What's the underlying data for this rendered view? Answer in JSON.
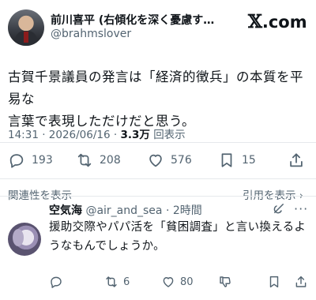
{
  "tweet": {
    "author_name": "前川喜平 (右傾化を深く憂慮す…",
    "author_handle": "@brahmslover",
    "brand": ".com",
    "text_line1": "古賀千景議員の発言は「経済的徴兵」の本質を平易な",
    "text_line2": "言葉で表現しただけだと思う。",
    "time": "14:31 · 2026/06/16 · ",
    "views_count": "3.3万",
    "views_label": "回表示",
    "replies": "193",
    "retweets": "208",
    "likes": "576",
    "bookmarks": "15",
    "related_label": "関連性を表示",
    "quote_label": "引用を表示 ›"
  },
  "reply": {
    "name": "空気海",
    "handle": "@air_and_sea",
    "time": "· 2時間",
    "text": "援助交際やパパ活を「貧困調査」と言い換えるようなもんでしょうか。",
    "replies": "",
    "retweets": "6",
    "likes": "80"
  }
}
